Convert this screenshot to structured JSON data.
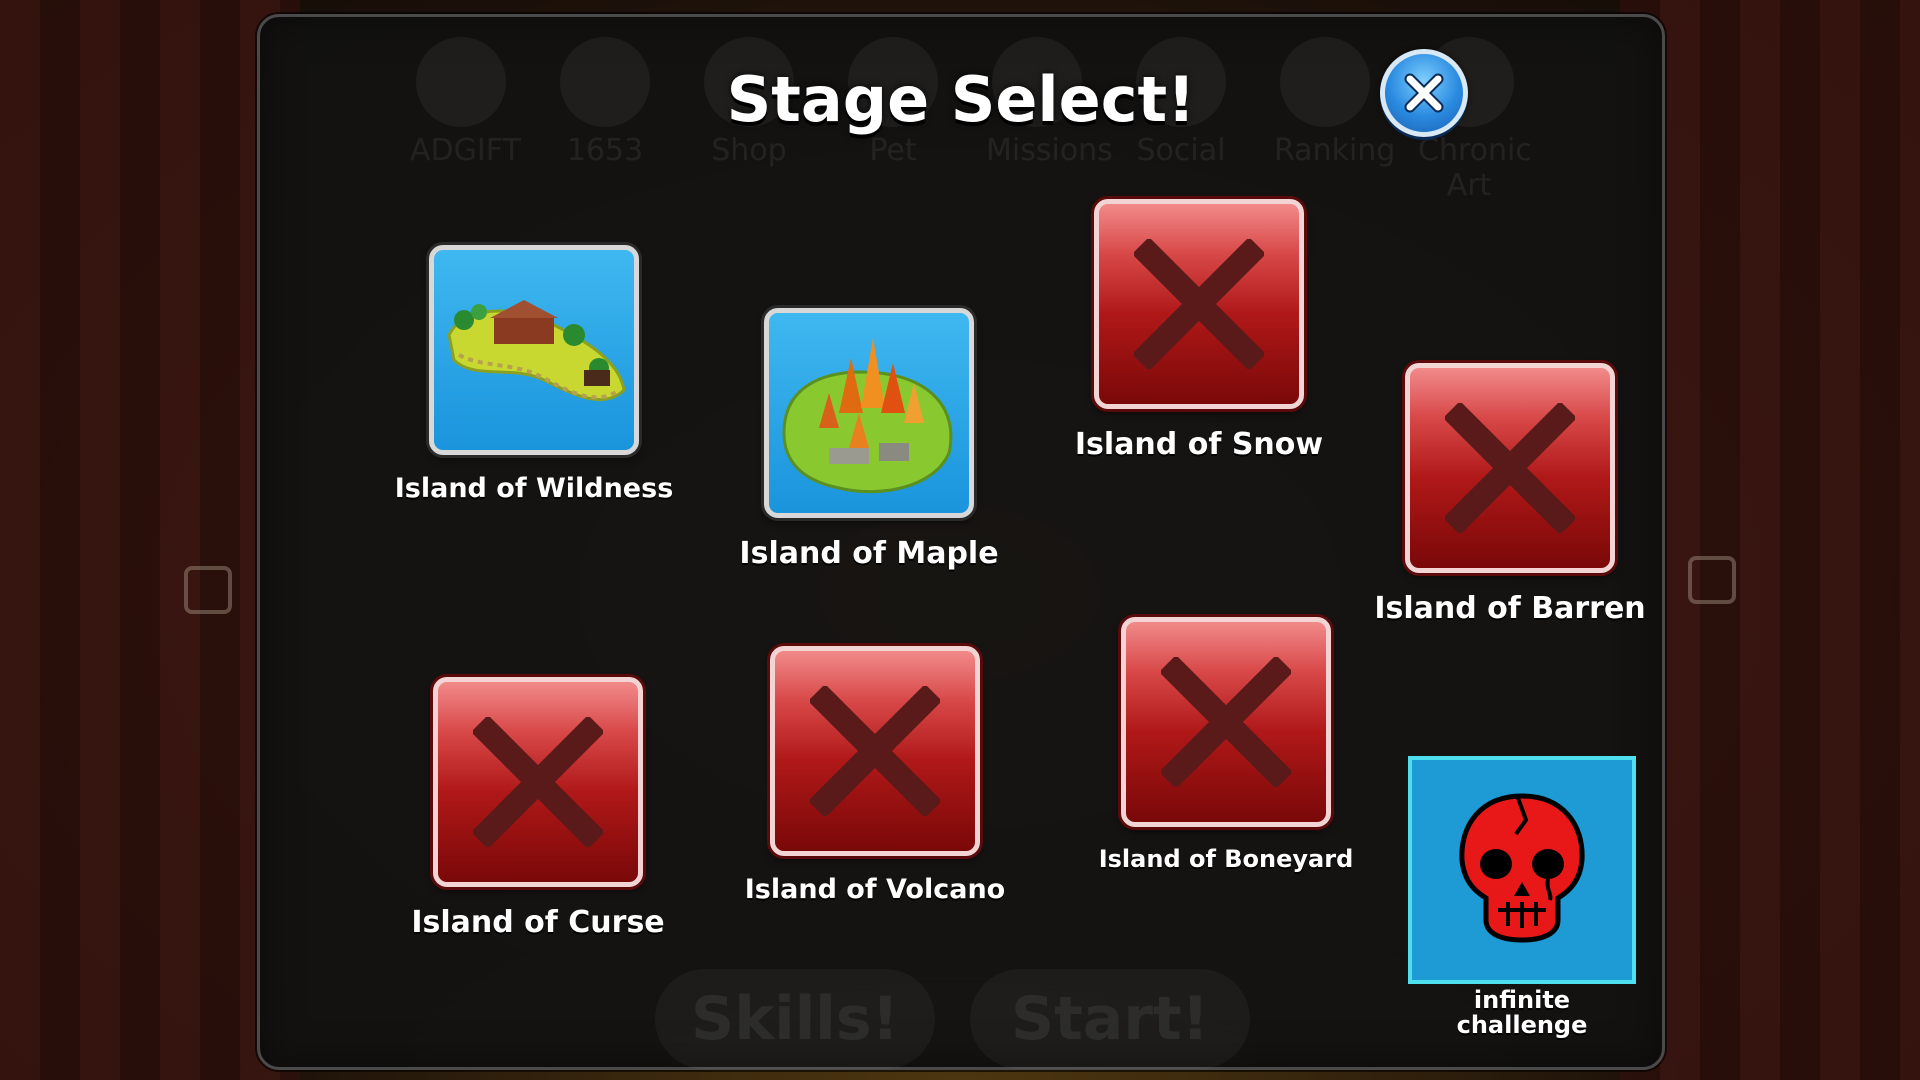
{
  "title": "Stage Select!",
  "background_menu": {
    "items": [
      "ADGIFT",
      "1653",
      "Shop",
      "Pet",
      "Missions",
      "Social",
      "Ranking",
      "Chronic Art"
    ],
    "skills_label": "Skills!",
    "start_label": "Start!"
  },
  "stages": [
    {
      "id": "wildness",
      "label": "Island of Wildness",
      "locked": false
    },
    {
      "id": "maple",
      "label": "Island of Maple",
      "locked": false
    },
    {
      "id": "snow",
      "label": "Island of Snow",
      "locked": true
    },
    {
      "id": "barren",
      "label": "Island of Barren",
      "locked": true
    },
    {
      "id": "curse",
      "label": "Island of Curse",
      "locked": true
    },
    {
      "id": "volcano",
      "label": "Island of Volcano",
      "locked": true
    },
    {
      "id": "boneyard",
      "label": "Island of Boneyard",
      "locked": true
    }
  ],
  "infinite": {
    "label": "infinite\nchallenge",
    "icon": "skull-icon"
  },
  "colors": {
    "locked_red": "#b01818",
    "open_blue": "#1a94dc",
    "infinite_blue": "#1e9ad4",
    "close_blue": "#2a8ae0"
  }
}
